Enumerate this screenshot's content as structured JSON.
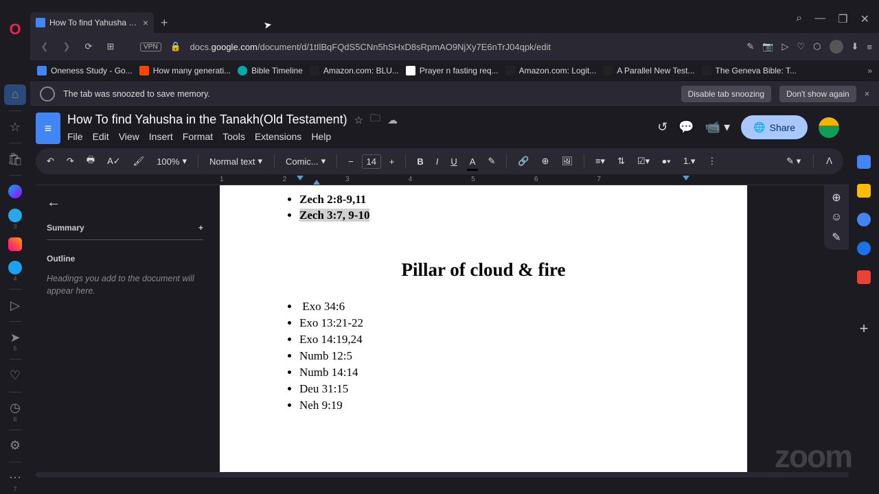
{
  "browser": {
    "tab_title": "How To find Yahusha in the",
    "url_prefix": "docs.",
    "url_domain": "google.com",
    "url_path": "/document/d/1tIlBqFQdS5CNn5hSHxD8sRpmAO9NjXy7E6nTrJ04qpk/edit",
    "vpn": "VPN"
  },
  "bookmarks": [
    "Oneness Study - Go...",
    "How many generati...",
    "Bible Timeline",
    "Amazon.com: BLU...",
    "Prayer n fasting req...",
    "Amazon.com: Logit...",
    "A Parallel New Test...",
    "The Geneva Bible: T..."
  ],
  "snooze": {
    "msg": "The tab was snoozed to save memory.",
    "disable": "Disable tab snoozing",
    "dont_show": "Don't show again"
  },
  "docs": {
    "title": "How To find Yahusha in the Tanakh(Old Testament)",
    "menus": [
      "File",
      "Edit",
      "View",
      "Insert",
      "Format",
      "Tools",
      "Extensions",
      "Help"
    ],
    "share": "Share"
  },
  "toolbar": {
    "zoom": "100%",
    "style": "Normal text",
    "font": "Comic...",
    "size": "14"
  },
  "outline": {
    "summary": "Summary",
    "heading": "Outline",
    "hint": "Headings you add to the document will appear here."
  },
  "chart_data": {
    "type": "table",
    "top_bullets": [
      "Zech 2:8-9,11",
      "Zech 3:7, 9-10"
    ],
    "section_title": "Pillar of cloud & fire",
    "bullets": [
      "Exo 34:6",
      "Exo 13:21-22",
      "Exo 14:19,24",
      "Numb 12:5",
      "Numb 14:14",
      "Deu 31:15",
      "Neh 9:19"
    ]
  },
  "ruler": [
    "1",
    "2",
    "3",
    "4",
    "5",
    "6",
    "7"
  ],
  "zoom_wm": "zoom"
}
